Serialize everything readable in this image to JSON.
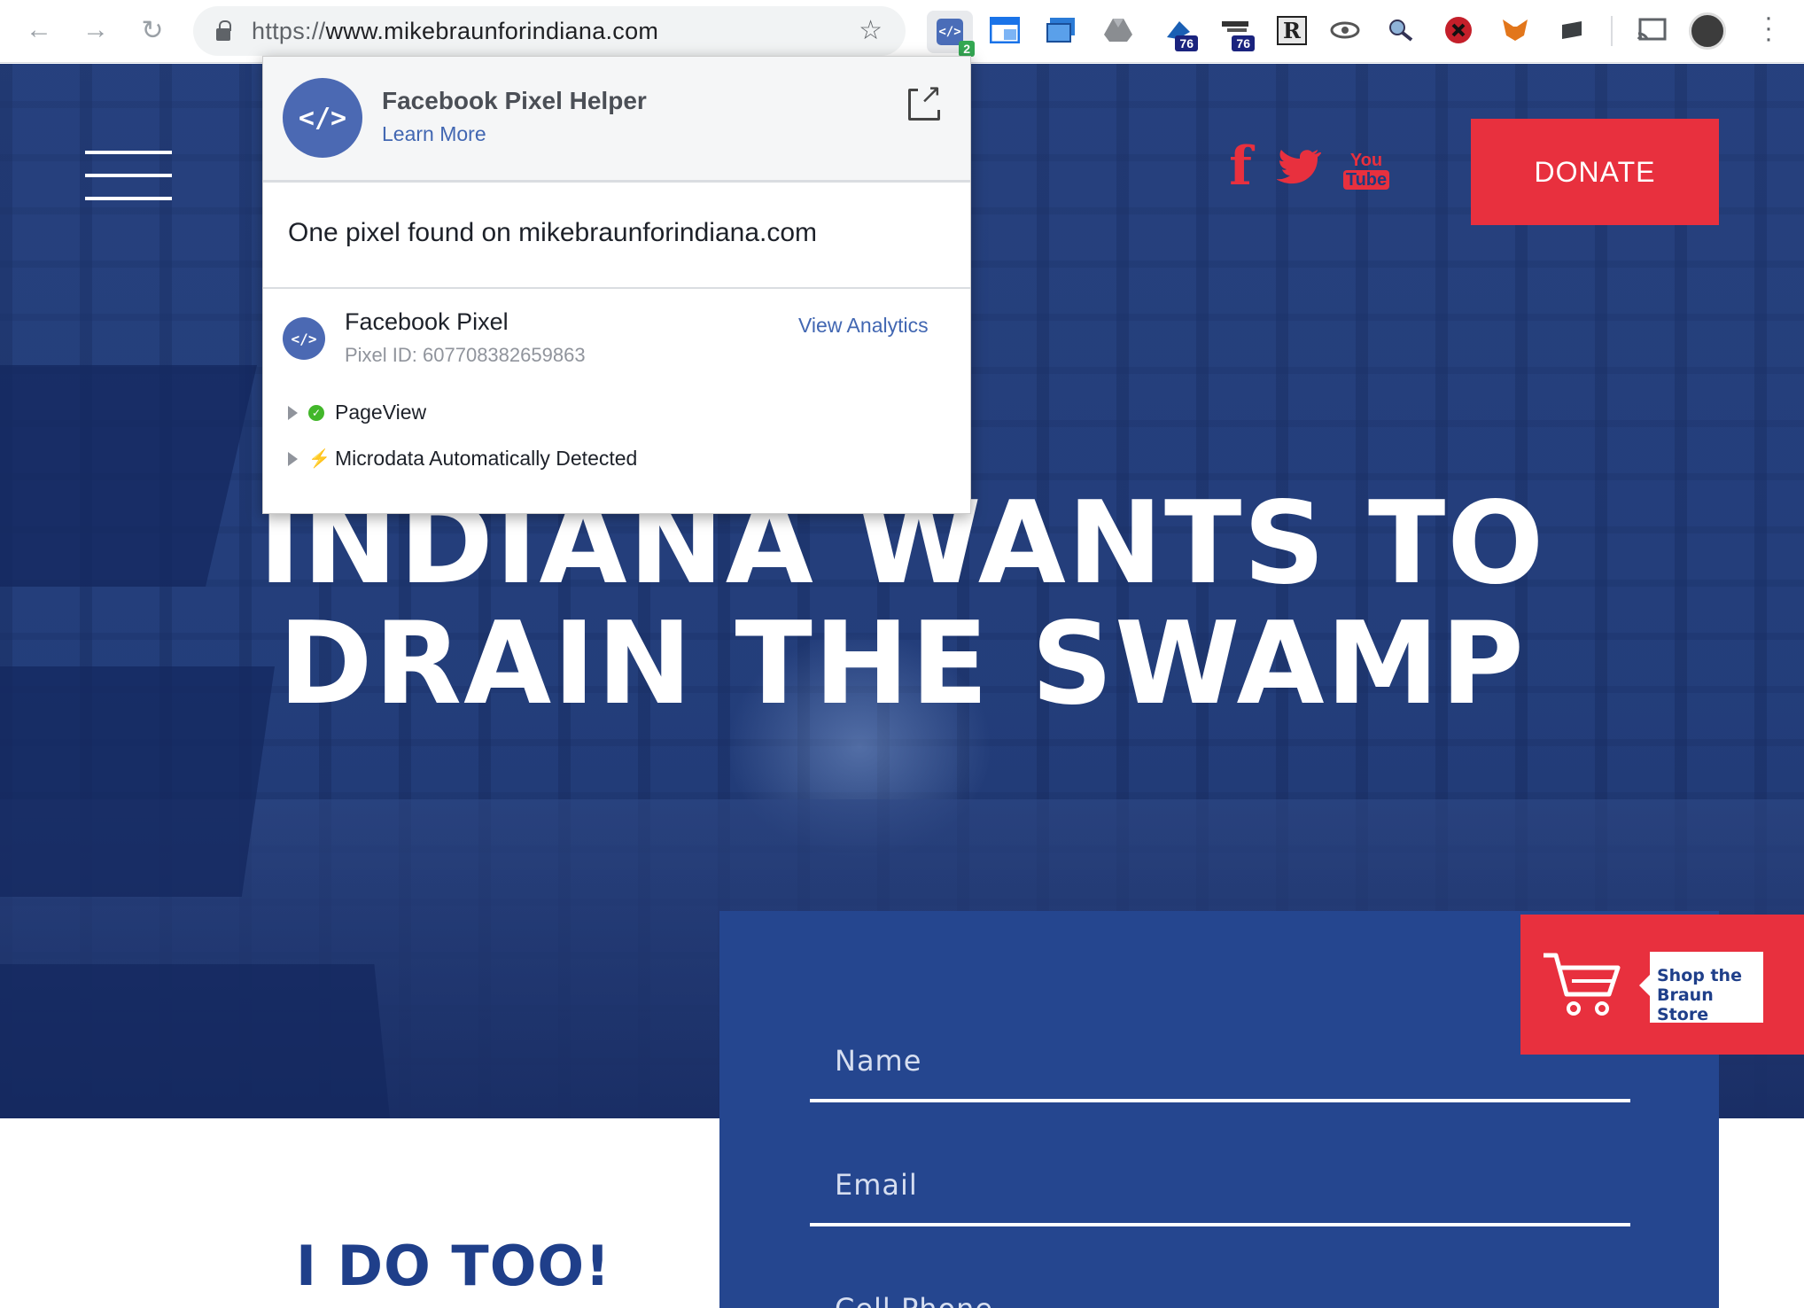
{
  "browser": {
    "url_scheme": "https://",
    "url_host": "www.mikebraunforindiana.com",
    "extensions": [
      {
        "name": "facebook-pixel-helper-extension-icon",
        "badge": "2"
      },
      {
        "name": "window-extension-icon"
      },
      {
        "name": "screenshot-extension-icon"
      },
      {
        "name": "google-drive-extension-icon"
      },
      {
        "name": "extension-icon-76a",
        "badge": "76"
      },
      {
        "name": "extension-icon-76b",
        "badge": "76"
      },
      {
        "name": "readability-extension-icon",
        "glyph": "R"
      },
      {
        "name": "eye-extension-icon"
      },
      {
        "name": "magnifier-extension-icon"
      },
      {
        "name": "blocker-extension-icon"
      },
      {
        "name": "metamask-extension-icon"
      },
      {
        "name": "slides-extension-icon"
      }
    ]
  },
  "popup": {
    "title": "Facebook Pixel Helper",
    "learn_more": "Learn More",
    "found_text": "One pixel found on mikebraunforindiana.com",
    "pixel_name": "Facebook Pixel",
    "pixel_id": "Pixel ID: 607708382659863",
    "view_analytics": "View Analytics",
    "events": [
      "PageView",
      "Microdata Automatically Detected"
    ],
    "logo_glyph": "</>"
  },
  "site": {
    "social": {
      "facebook": "f",
      "youtube_top": "You",
      "youtube_bottom": "Tube"
    },
    "donate": "DONATE",
    "headline_line1": "INDIANA WANTS TO",
    "headline_line2": "DRAIN THE SWAMP",
    "form": {
      "name": "Name",
      "email": "Email",
      "phone": "Cell Phone"
    },
    "store": "Shop the Braun Store",
    "subheading": "I DO TOO!"
  },
  "colors": {
    "accent_red": "#e8303e",
    "brand_blue": "#25468f",
    "fb_blue": "#4267b2"
  }
}
